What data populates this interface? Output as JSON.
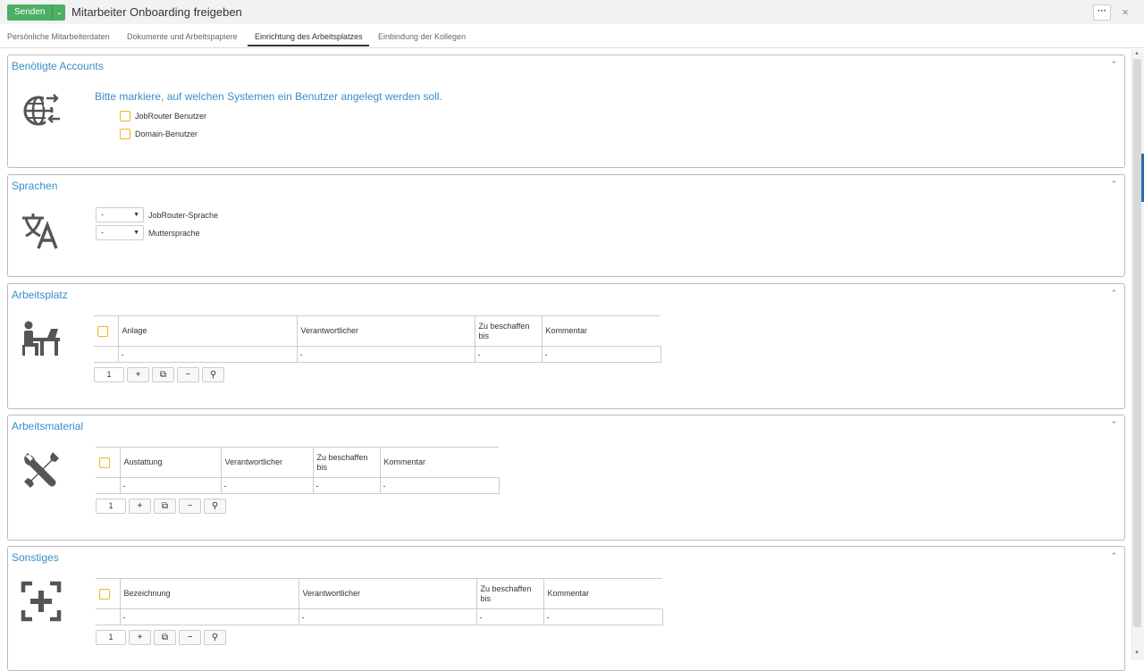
{
  "header": {
    "send_label": "Senden",
    "send_dropdown_icon": "chevron-down-icon",
    "title": "Mitarbeiter Onboarding freigeben",
    "more_label": "···",
    "close_label": "×"
  },
  "tabs": [
    {
      "label": "Persönliche Mitarbeiterdaten"
    },
    {
      "label": "Dokumente und Arbeitspapiere"
    },
    {
      "label": "Einrichtung des Arbeitsplatzes"
    },
    {
      "label": "Einbindung der Kollegen"
    }
  ],
  "accounts": {
    "title": "Benötigte Accounts",
    "icon": "globe-network-icon",
    "instruction": "Bitte markiere, auf welchen Systemen ein Benutzer angelegt werden soll.",
    "options": [
      {
        "label": "JobRouter Benutzer"
      },
      {
        "label": "Domain-Benutzer"
      }
    ]
  },
  "sprachen": {
    "title": "Sprachen",
    "icon": "translate-icon",
    "fields": [
      {
        "value": "-",
        "label": "JobRouter-Sprache"
      },
      {
        "value": "-",
        "label": "Muttersprache"
      }
    ]
  },
  "arbeitsplatz": {
    "title": "Arbeitsplatz",
    "icon": "desk-worker-icon",
    "columns": [
      "Anlage",
      "Verantwortlicher",
      "Zu beschaffen bis",
      "Kommentar"
    ],
    "rows": [
      [
        "-",
        "-",
        "-",
        "-"
      ]
    ],
    "row_count": "1"
  },
  "arbeitsmaterial": {
    "title": "Arbeitsmaterial",
    "icon": "tools-icon",
    "columns": [
      "Austattung",
      "Verantwortlicher",
      "Zu beschaffen bis",
      "Kommentar"
    ],
    "rows": [
      [
        "-",
        "-",
        "-",
        "-"
      ]
    ],
    "row_count": "1"
  },
  "sonstiges": {
    "title": "Sonstiges",
    "icon": "add-box-icon",
    "columns": [
      "Bezeichnung",
      "Verantwortlicher",
      "Zu beschaffen bis",
      "Kommentar"
    ],
    "rows": [
      [
        "-",
        "-",
        "-",
        "-"
      ]
    ],
    "row_count": "1"
  },
  "toolbar": {
    "add": "+",
    "copy": "⧉",
    "remove": "−",
    "search": "⚲"
  },
  "panel_collapse": "⌃",
  "colors": {
    "accent": "#3a8fc7",
    "send_button": "#4caf64",
    "checkbox_border": "#f1b51c"
  }
}
